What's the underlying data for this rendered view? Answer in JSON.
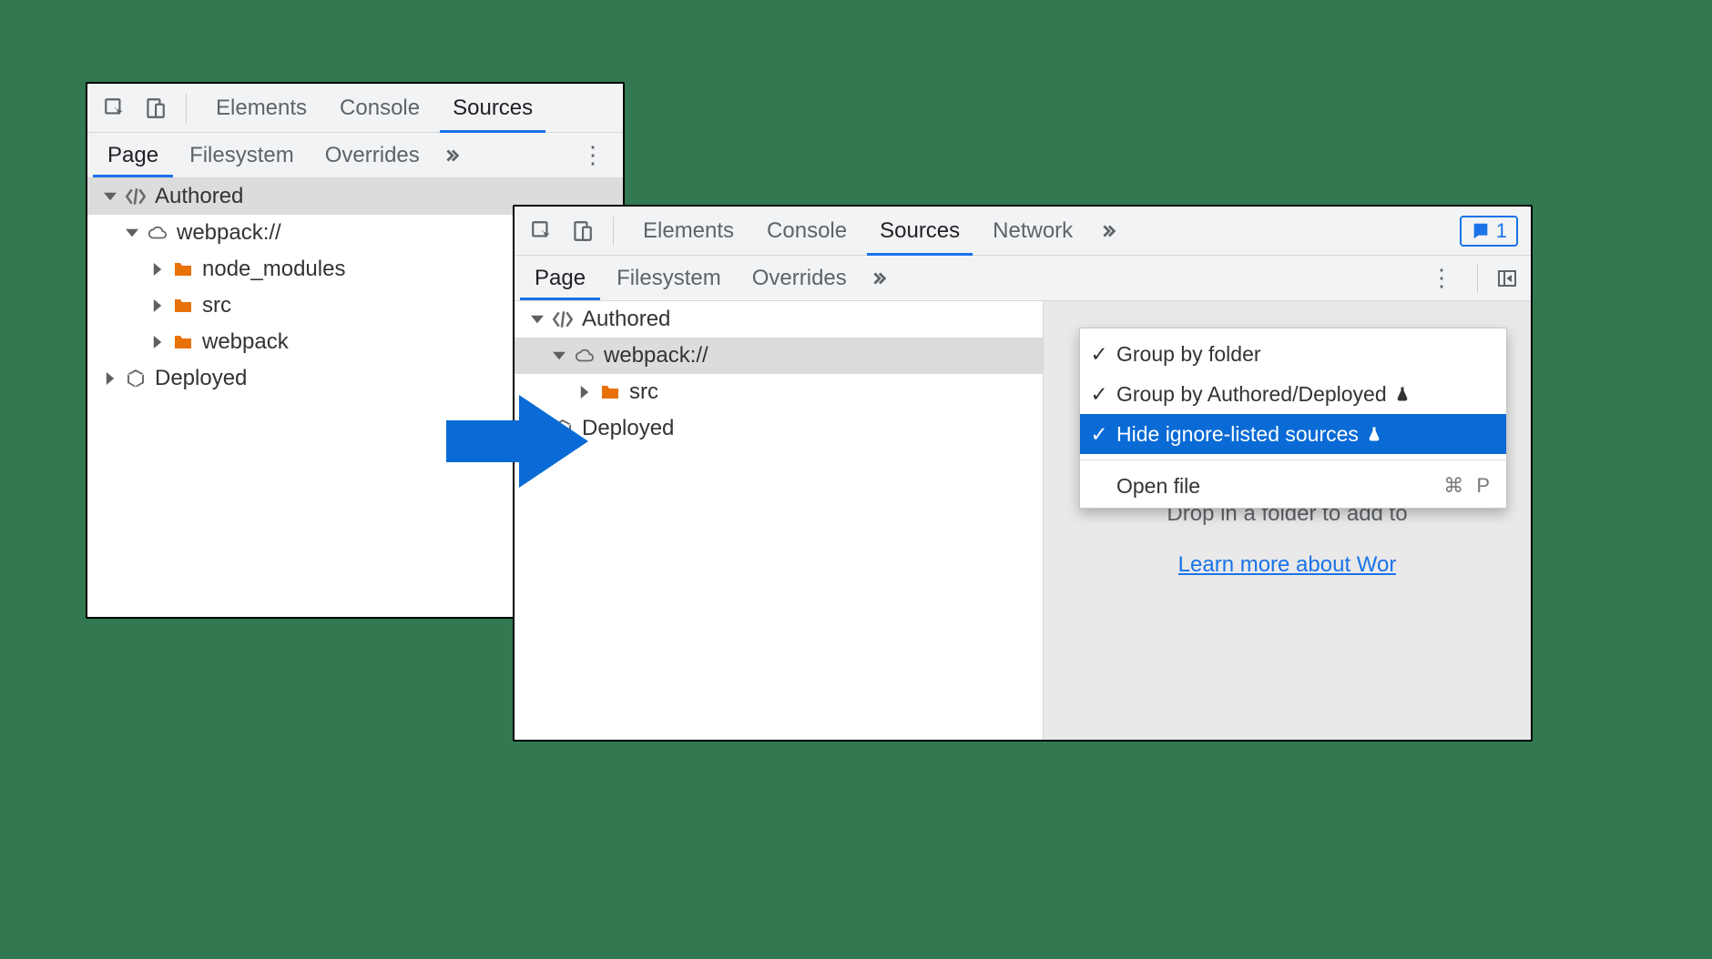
{
  "left": {
    "top_tabs": [
      "Elements",
      "Console",
      "Sources"
    ],
    "top_active": "Sources",
    "sub_tabs": [
      "Page",
      "Filesystem",
      "Overrides"
    ],
    "sub_active": "Page",
    "tree": {
      "authored": "Authored",
      "webpack": "webpack://",
      "nodes": [
        "node_modules",
        "src",
        "webpack"
      ],
      "deployed": "Deployed"
    }
  },
  "right": {
    "top_tabs": [
      "Elements",
      "Console",
      "Sources",
      "Network"
    ],
    "top_active": "Sources",
    "badge_count": "1",
    "sub_tabs": [
      "Page",
      "Filesystem",
      "Overrides"
    ],
    "sub_active": "Page",
    "tree": {
      "authored": "Authored",
      "webpack": "webpack://",
      "nodes": [
        "src"
      ],
      "deployed": "Deployed"
    },
    "hint": "Drop in a folder to add to",
    "link": "Learn more about Wor"
  },
  "menu": {
    "group_folder": "Group by folder",
    "group_auth": "Group by Authored/Deployed",
    "hide_ignored": "Hide ignore-listed sources",
    "open_file": "Open file",
    "open_file_key": "⌘ P"
  }
}
